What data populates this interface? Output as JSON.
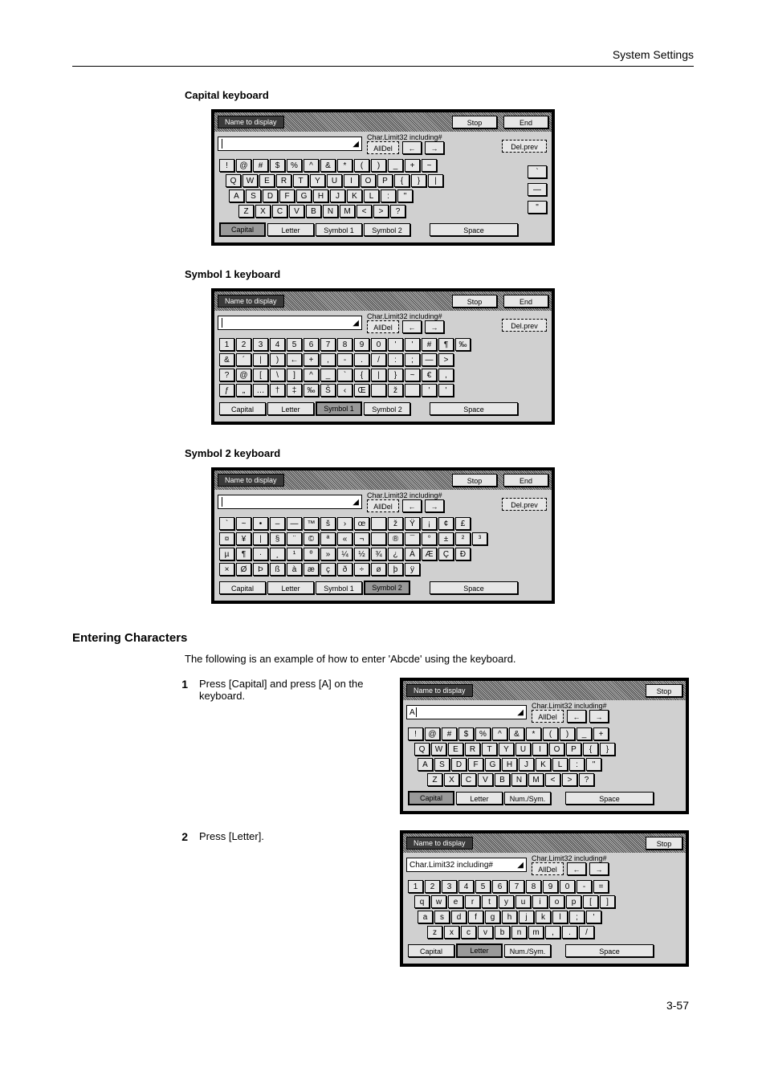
{
  "header": {
    "section": "System Settings"
  },
  "sub_headings": {
    "capital": "Capital keyboard",
    "sym1": "Symbol 1 keyboard",
    "sym2": "Symbol 2 keyboard"
  },
  "labels": {
    "name_to_display": "Name to display",
    "char_limit": "Char.Limit32 including#",
    "all_del": "AllDel",
    "del_prev": "Del.prev",
    "stop": "Stop",
    "end": "End",
    "space": "Space",
    "left": "←",
    "right": "→"
  },
  "tabs": {
    "capital": "Capital",
    "letter": "Letter",
    "symbol1": "Symbol 1",
    "symbol2": "Symbol 2",
    "numsym": "Num./Sym."
  },
  "kb_capital": {
    "row1": [
      "!",
      "@",
      "#",
      "$",
      "%",
      "^",
      "&",
      "*",
      "(",
      ")",
      "_",
      "+",
      "~"
    ],
    "row2": [
      "Q",
      "W",
      "E",
      "R",
      "T",
      "Y",
      "U",
      "I",
      "O",
      "P",
      "{",
      "}",
      "|"
    ],
    "row3": [
      "A",
      "S",
      "D",
      "F",
      "G",
      "H",
      "J",
      "K",
      "L",
      ":",
      "\""
    ],
    "row4": [
      "Z",
      "X",
      "C",
      "V",
      "B",
      "N",
      "M",
      "<",
      ">",
      "?"
    ],
    "side": [
      "`",
      "—",
      "\""
    ]
  },
  "kb_sym1": {
    "row1": [
      "1",
      "2",
      "3",
      "4",
      "5",
      "6",
      "7",
      "8",
      "9",
      "0",
      "'",
      "'",
      "#",
      "¶",
      "‰"
    ],
    "row2": [
      "&",
      "´",
      "|",
      ")",
      "←",
      "+",
      ",",
      "-",
      ".",
      "/",
      ":",
      ";",
      "—",
      ">"
    ],
    "row3": [
      "?",
      "@",
      "[",
      "\\",
      "]",
      "^",
      "_",
      "`",
      "{",
      "|",
      "}",
      "~",
      "€",
      ","
    ],
    "row4": [
      "ƒ",
      "„",
      "…",
      "†",
      "‡",
      "‰",
      "Š",
      "‹",
      "Œ",
      "",
      "ž",
      "",
      "'",
      "'"
    ]
  },
  "kb_sym2": {
    "row1": [
      "`",
      "~",
      "•",
      "–",
      "—",
      "™",
      "š",
      "›",
      "œ",
      "",
      "ž",
      "Ÿ",
      "¡",
      "¢",
      "£"
    ],
    "row2": [
      "¤",
      "¥",
      "|",
      "§",
      "¨",
      "©",
      "ª",
      "«",
      "¬",
      "­",
      "®",
      "¯",
      "°",
      "±",
      "²",
      "³"
    ],
    "row3": [
      "µ",
      "¶",
      "·",
      "¸",
      "¹",
      "º",
      "»",
      "¼",
      "½",
      "¾",
      "¿",
      "À",
      "Æ",
      "Ç",
      "Ð"
    ],
    "row4": [
      "×",
      "Ø",
      "Þ",
      "ß",
      "à",
      "æ",
      "ç",
      "ð",
      "÷",
      "ø",
      "þ",
      "ÿ"
    ]
  },
  "kb_step1": {
    "input": "A",
    "row1": [
      "!",
      "@",
      "#",
      "$",
      "%",
      "^",
      "&",
      "*",
      "(",
      ")",
      "_",
      "+"
    ],
    "row2": [
      "Q",
      "W",
      "E",
      "R",
      "T",
      "Y",
      "U",
      "I",
      "O",
      "P",
      "{",
      "}"
    ],
    "row3": [
      "A",
      "S",
      "D",
      "F",
      "G",
      "H",
      "J",
      "K",
      "L",
      ":",
      "\""
    ],
    "row4": [
      "Z",
      "X",
      "C",
      "V",
      "B",
      "N",
      "M",
      "<",
      ">",
      "?"
    ]
  },
  "kb_step2": {
    "input": "Char.Limit32 including#",
    "row1": [
      "1",
      "2",
      "3",
      "4",
      "5",
      "6",
      "7",
      "8",
      "9",
      "0",
      "-",
      "="
    ],
    "row2": [
      "q",
      "w",
      "e",
      "r",
      "t",
      "y",
      "u",
      "i",
      "o",
      "p",
      "[",
      "]"
    ],
    "row3": [
      "a",
      "s",
      "d",
      "f",
      "g",
      "h",
      "j",
      "k",
      "l",
      ";",
      "'"
    ],
    "row4": [
      "z",
      "x",
      "c",
      "v",
      "b",
      "n",
      "m",
      ",",
      ".",
      "/"
    ]
  },
  "section": {
    "heading": "Entering Characters",
    "intro": "The following is an example of how to enter 'Abcde' using the keyboard."
  },
  "steps": {
    "s1_num": "1",
    "s1_text": "Press [Capital] and press [A] on the keyboard.",
    "s2_num": "2",
    "s2_text": "Press [Letter]."
  },
  "pagenum": "3-57"
}
